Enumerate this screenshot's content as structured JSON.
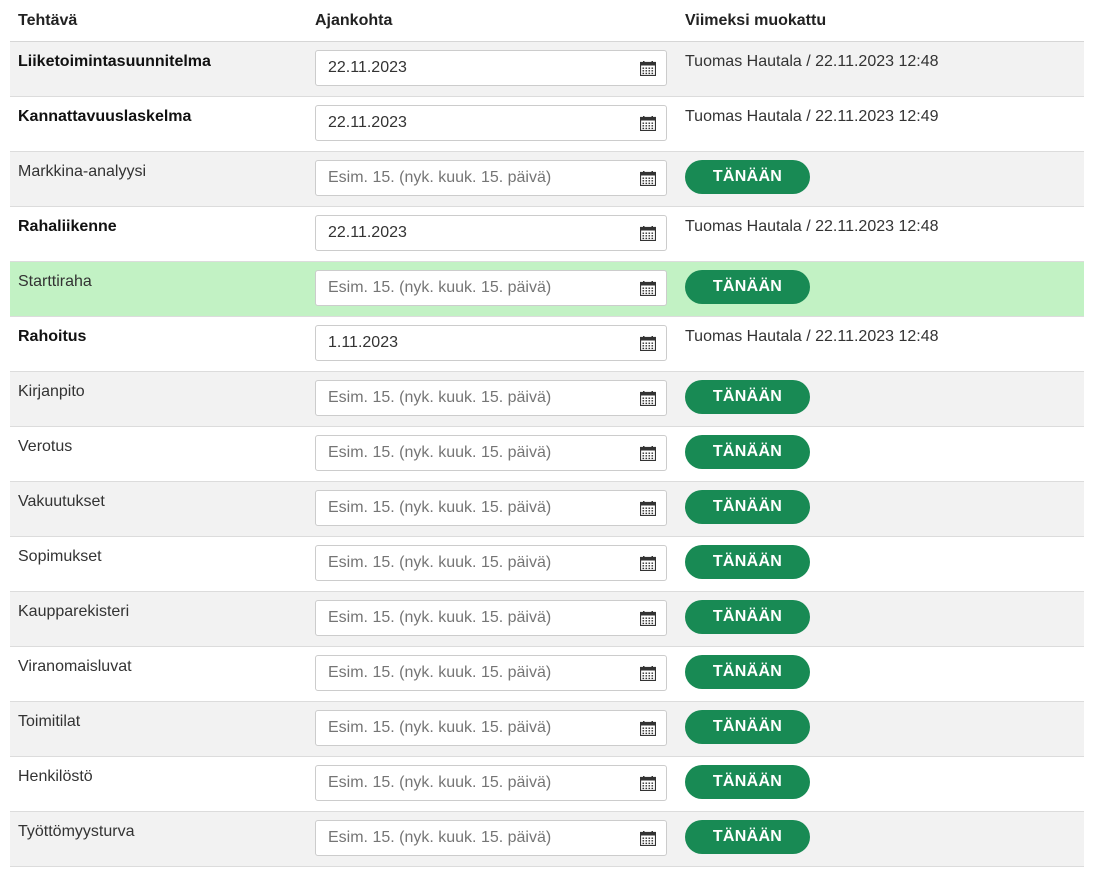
{
  "headers": {
    "task": "Tehtävä",
    "date": "Ajankohta",
    "modified": "Viimeksi muokattu"
  },
  "placeholder": "Esim. 15. (nyk. kuuk. 15. päivä)",
  "today_label": "TÄNÄÄN",
  "accent": "#188a54",
  "highlight": "#c2f2c4",
  "rows": [
    {
      "task": "Liiketoimintasuunnitelma",
      "date": "22.11.2023",
      "modified": "Tuomas Hautala / 22.11.2023 12:48"
    },
    {
      "task": "Kannattavuuslaskelma",
      "date": "22.11.2023",
      "modified": "Tuomas Hautala / 22.11.2023 12:49"
    },
    {
      "task": "Markkina-analyysi",
      "date": "",
      "modified": ""
    },
    {
      "task": "Rahaliikenne",
      "date": "22.11.2023",
      "modified": "Tuomas Hautala / 22.11.2023 12:48"
    },
    {
      "task": "Starttiraha",
      "date": "",
      "modified": ""
    },
    {
      "task": "Rahoitus",
      "date": "1.11.2023",
      "modified": "Tuomas Hautala / 22.11.2023 12:48"
    },
    {
      "task": "Kirjanpito",
      "date": "",
      "modified": ""
    },
    {
      "task": "Verotus",
      "date": "",
      "modified": ""
    },
    {
      "task": "Vakuutukset",
      "date": "",
      "modified": ""
    },
    {
      "task": "Sopimukset",
      "date": "",
      "modified": ""
    },
    {
      "task": "Kaupparekisteri",
      "date": "",
      "modified": ""
    },
    {
      "task": "Viranomaisluvat",
      "date": "",
      "modified": ""
    },
    {
      "task": "Toimitilat",
      "date": "",
      "modified": ""
    },
    {
      "task": "Henkilöstö",
      "date": "",
      "modified": ""
    },
    {
      "task": "Työttömyysturva",
      "date": "",
      "modified": ""
    }
  ]
}
